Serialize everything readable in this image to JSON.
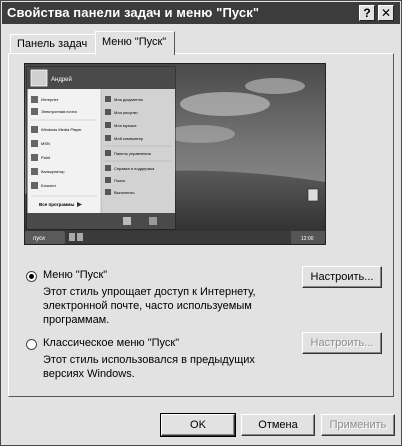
{
  "window": {
    "title": "Свойства панели задач и меню \"Пуск\"",
    "help_label": "?",
    "close_label": "✕"
  },
  "tabs": [
    {
      "label": "Панель задач",
      "active": false
    },
    {
      "label": "Меню \"Пуск\"",
      "active": true
    }
  ],
  "preview": {
    "user_name": "Андрей",
    "start_label": "пуск",
    "time": "12:00",
    "left_items": [
      "Интернет",
      "Электронная почта",
      "Windows Media Player",
      "MSN",
      "Paint",
      "Калькулятор",
      "Блокнот"
    ],
    "all_programs": "Все программы",
    "right_items": [
      "Мои документы",
      "Мои рисунки",
      "Моя музыка",
      "Мой компьютер",
      "Панель управления",
      "Справка и поддержка",
      "Поиск",
      "Выполнить"
    ]
  },
  "options": {
    "start_menu": {
      "label": "Меню \"Пуск\"",
      "selected": true,
      "description": [
        "Этот стиль упрощает доступ к Интернету,",
        "электронной почте, часто используемым",
        "программам."
      ],
      "customize_label": "Настроить..."
    },
    "classic_menu": {
      "label": "Классическое меню \"Пуск\"",
      "selected": false,
      "description": [
        "Этот стиль использовался в предыдущих",
        "версиях Windows."
      ],
      "customize_label": "Настроить..."
    }
  },
  "footer": {
    "ok_label": "OK",
    "cancel_label": "Отмена",
    "apply_label": "Применить"
  },
  "colors": {
    "dialog_bg": "#e2e2e2",
    "titlebar": "#3c3c3c",
    "disabled_text": "#8a8a8a"
  }
}
